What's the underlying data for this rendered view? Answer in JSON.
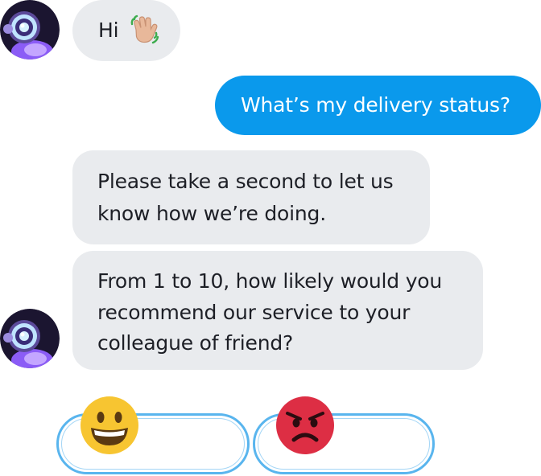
{
  "messages": [
    {
      "from": "bot",
      "text": "Hi",
      "emoji": "waving-hand"
    },
    {
      "from": "user",
      "text": "What’s my delivery status?"
    },
    {
      "from": "bot",
      "text": "Please take a second to let us\nknow how we’re doing."
    },
    {
      "from": "bot",
      "text": "From 1 to 10, how likely would you\nrecommend our service to your\ncolleague of friend?"
    }
  ],
  "quick_replies": [
    {
      "icon": "grinning-face-icon"
    },
    {
      "icon": "angry-face-icon"
    }
  ],
  "colors": {
    "user_bubble": "#0a99ec",
    "bot_bubble": "#e9ebee",
    "reply_border": "#59b5ee"
  }
}
